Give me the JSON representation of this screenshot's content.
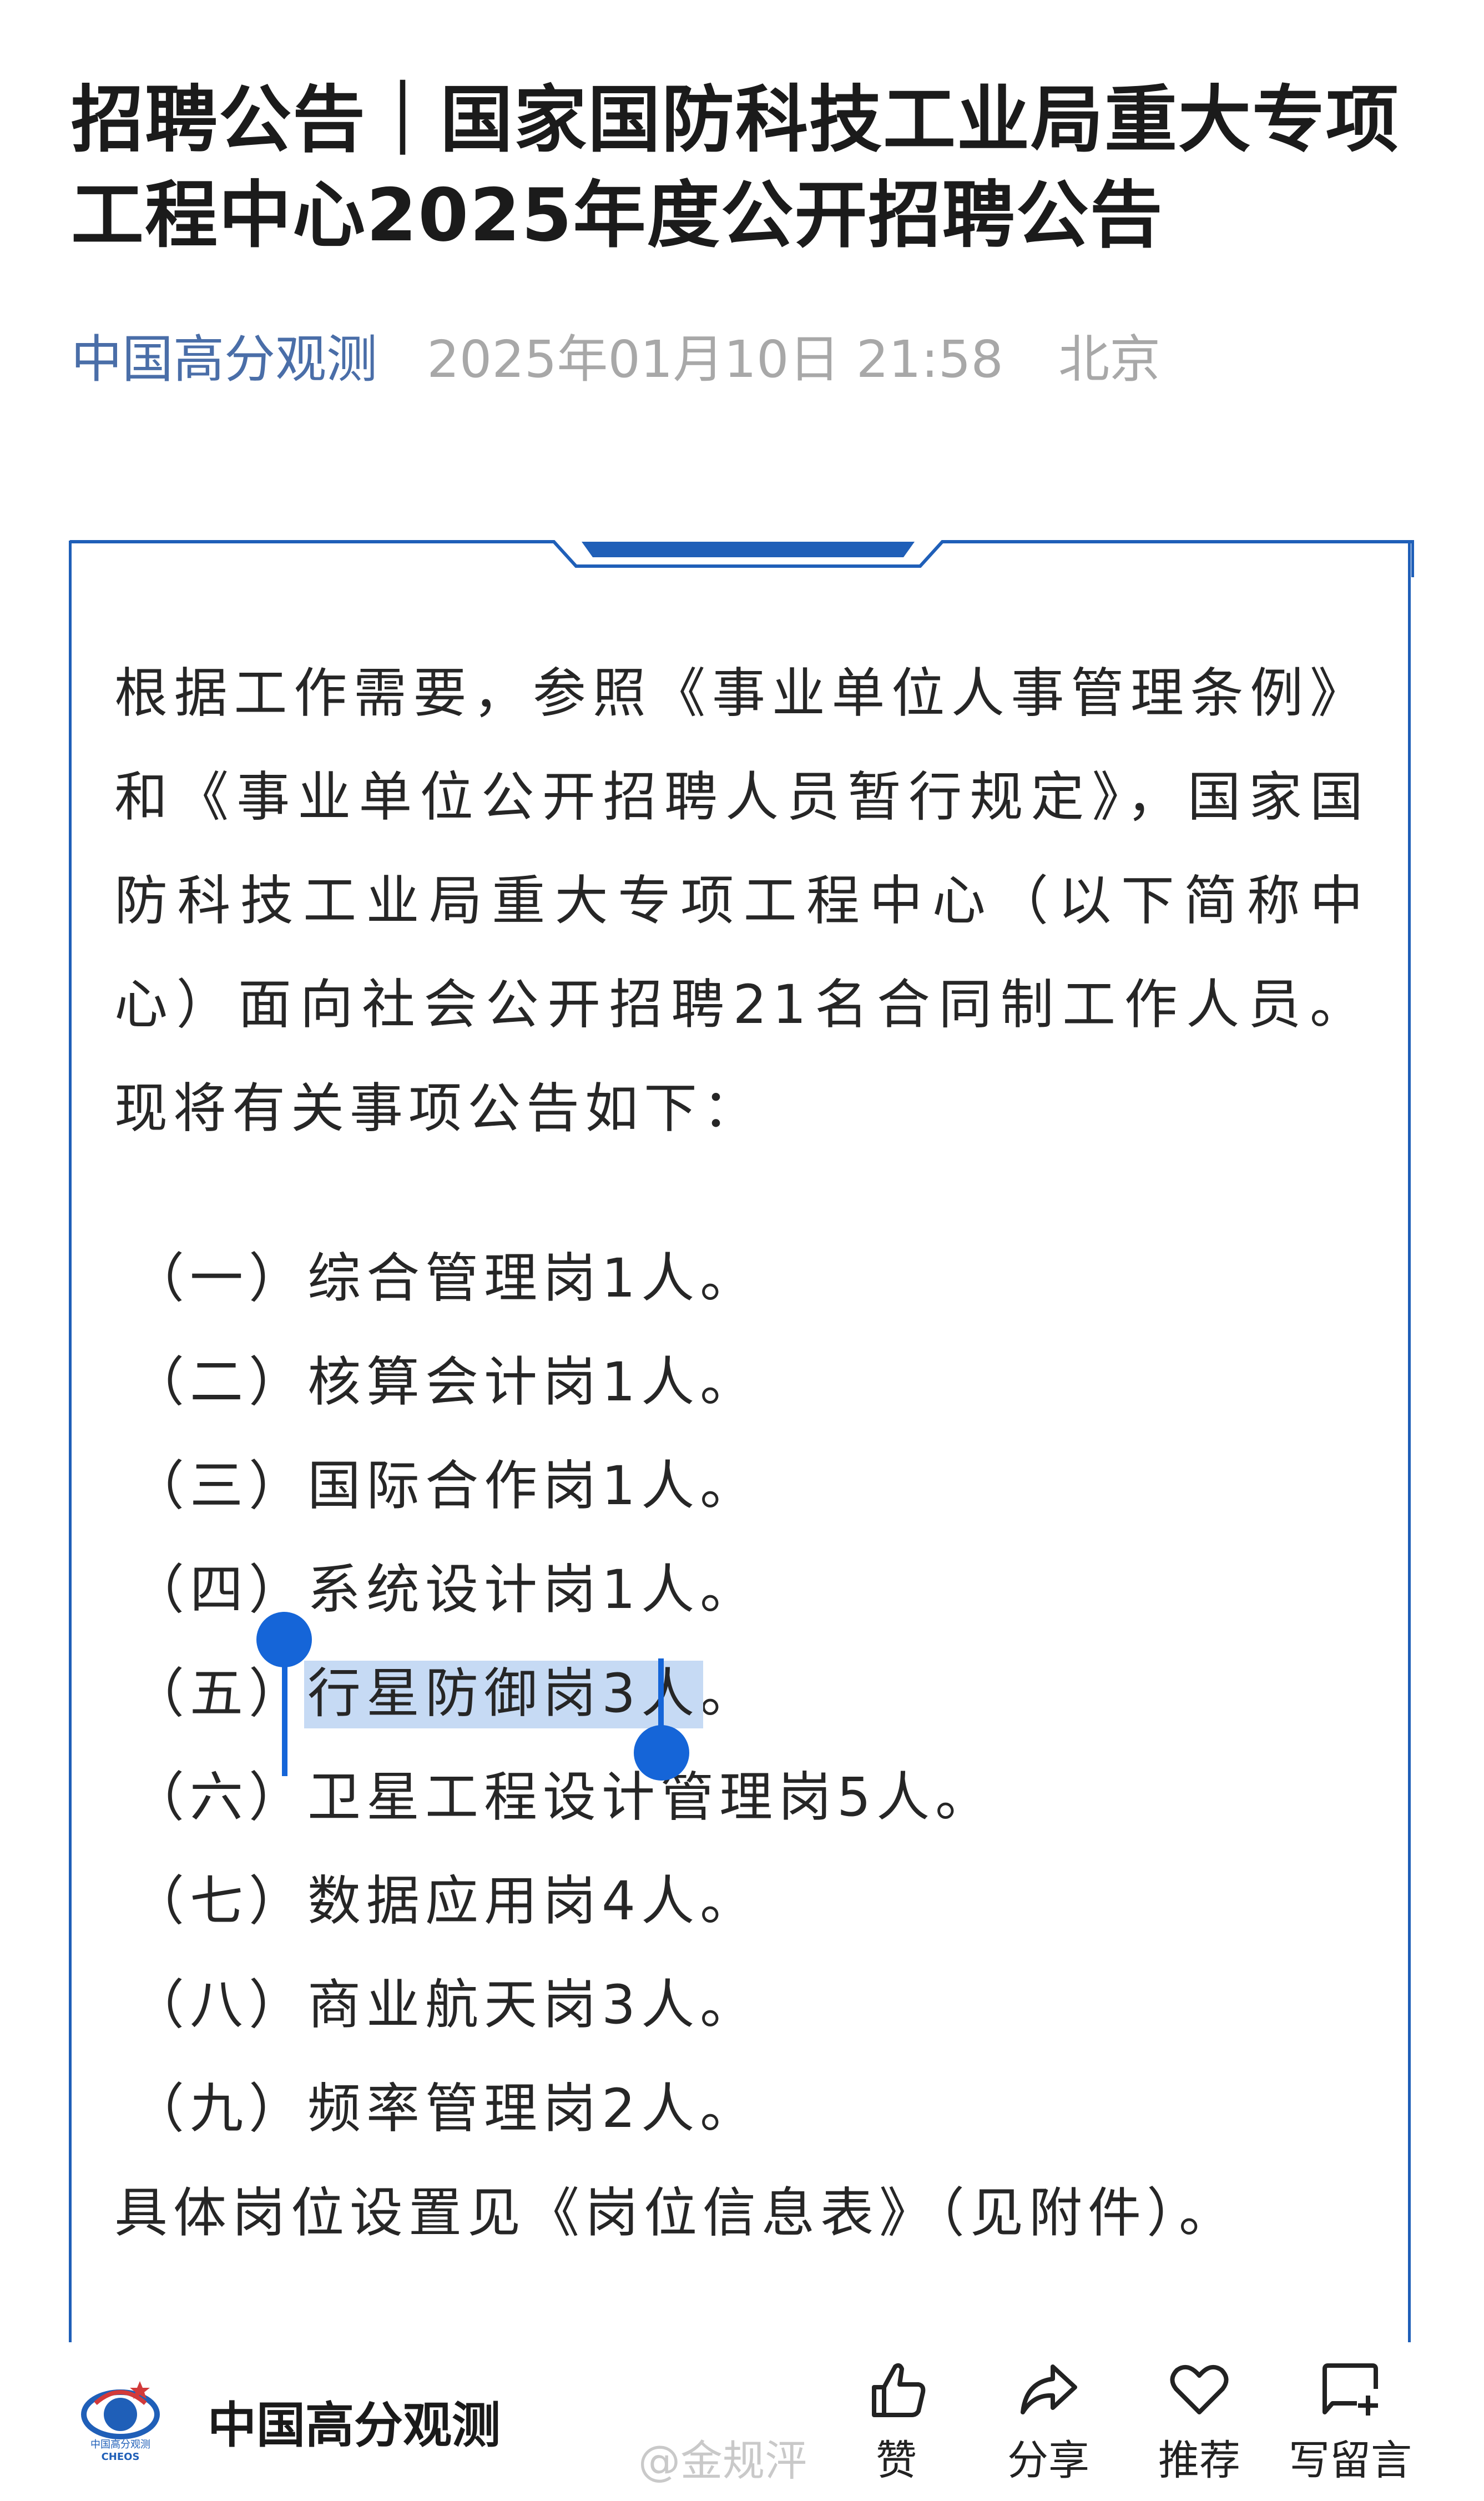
{
  "article": {
    "title": "招聘公告｜国家国防科技工业局重大专项工程中心2025年度公开招聘公告",
    "account": "中国高分观测",
    "datetime": "2025年01月10日  21:58",
    "location": "北京"
  },
  "content": {
    "intro": "根据工作需要，参照《事业单位人事管理条例》和《事业单位公开招聘人员暂行规定》，国家国防科技工业局重大专项工程中心（以下简称中心）面向社会公开招聘21名合同制工作人员。现将有关事项公告如下：",
    "positions": [
      {
        "num": "（一）",
        "text": "综合管理岗1人。"
      },
      {
        "num": "（二）",
        "text": "核算会计岗1人。"
      },
      {
        "num": "（三）",
        "text": "国际合作岗1人。"
      },
      {
        "num": "（四）",
        "text": "系统设计岗1人。"
      },
      {
        "num": "（五）",
        "text": "行星防御岗3人",
        "tail": "。"
      },
      {
        "num": "（六）",
        "text": "卫星工程设计管理岗5人。"
      },
      {
        "num": "（七）",
        "text": "数据应用岗4人。"
      },
      {
        "num": "（八）",
        "text": "商业航天岗3人。"
      },
      {
        "num": "（九）",
        "text": "频率管理岗2人。"
      }
    ],
    "closing": "具体岗位设置见《岗位信息表》（见附件）。"
  },
  "footer": {
    "account_name": "中国高分观测",
    "logo_text": "中国高分观测",
    "logo_sub": "CHEOS",
    "watermark": "@金规泙",
    "actions": {
      "like": "赞",
      "share": "分享",
      "recommend": "推荐",
      "comment": "写留言"
    }
  },
  "colors": {
    "accent": "#1f5fb8",
    "selection": "#c6daf4",
    "handle": "#1565d8",
    "account_link": "#4a6ea8",
    "meta_gray": "#a8a8a8"
  }
}
